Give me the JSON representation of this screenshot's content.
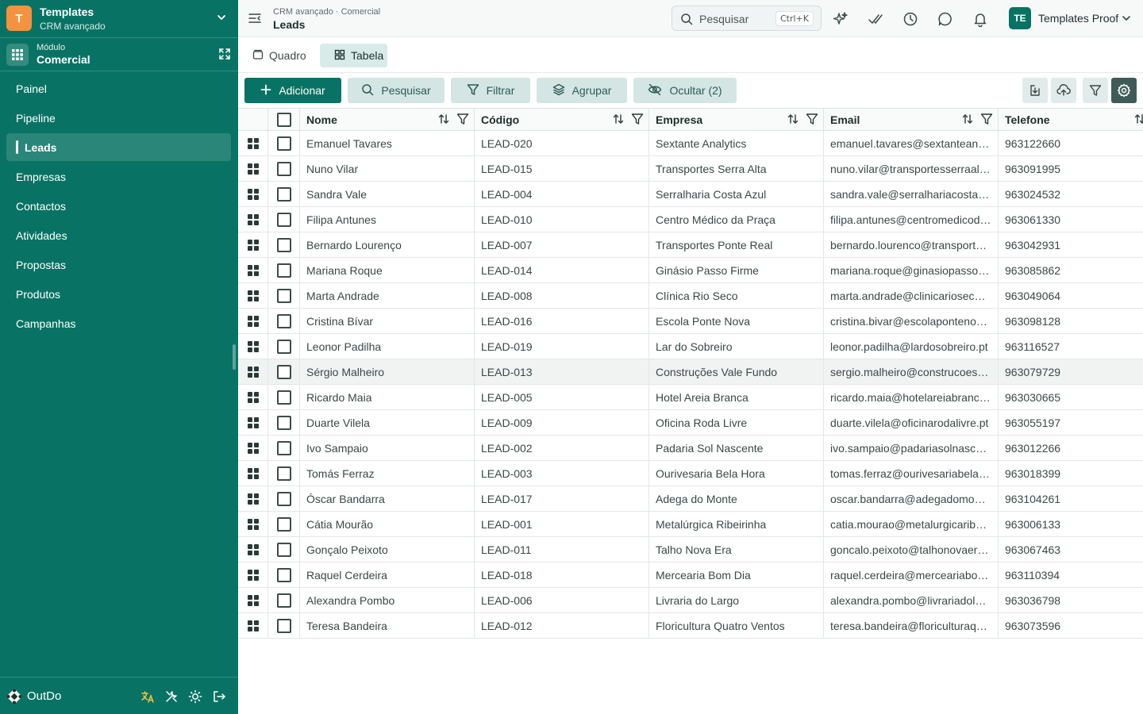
{
  "workspace": {
    "logo_letter": "T",
    "name": "Templates",
    "subtitle": "CRM avançado"
  },
  "module": {
    "label": "Módulo",
    "name": "Comercial"
  },
  "nav": [
    {
      "label": "Painel",
      "active": false
    },
    {
      "label": "Pipeline",
      "active": false
    },
    {
      "label": "Leads",
      "active": true
    },
    {
      "label": "Empresas",
      "active": false
    },
    {
      "label": "Contactos",
      "active": false
    },
    {
      "label": "Atividades",
      "active": false
    },
    {
      "label": "Propostas",
      "active": false
    },
    {
      "label": "Produtos",
      "active": false
    },
    {
      "label": "Campanhas",
      "active": false
    }
  ],
  "brand": {
    "name": "OutDo"
  },
  "header": {
    "breadcrumb": "CRM avançado · Comercial",
    "title": "Leads",
    "search_placeholder": "Pesquisar",
    "search_shortcut": "Ctrl+K",
    "user_initials": "TE",
    "user_name": "Templates Proof"
  },
  "views": {
    "board_label": "Quadro",
    "table_label": "Tabela",
    "active": "Tabela"
  },
  "toolbar": {
    "add_label": "Adicionar",
    "search_label": "Pesquisar",
    "filter_label": "Filtrar",
    "group_label": "Agrupar",
    "hide_label": "Ocultar (2)"
  },
  "columns": [
    "Nome",
    "Código",
    "Empresa",
    "Email",
    "Telefone"
  ],
  "rows": [
    {
      "nome": "Emanuel Tavares",
      "codigo": "LEAD-020",
      "empresa": "Sextante Analytics",
      "email": "emanuel.tavares@sextanteanaly…",
      "telefone": "963122660"
    },
    {
      "nome": "Nuno Vilar",
      "codigo": "LEAD-015",
      "empresa": "Transportes Serra Alta",
      "email": "nuno.vilar@transportesserraalta…",
      "telefone": "963091995"
    },
    {
      "nome": "Sandra Vale",
      "codigo": "LEAD-004",
      "empresa": "Serralharia Costa Azul",
      "email": "sandra.vale@serralhariacostaaz…",
      "telefone": "963024532"
    },
    {
      "nome": "Filipa Antunes",
      "codigo": "LEAD-010",
      "empresa": "Centro Médico da Praça",
      "email": "filipa.antunes@centromedicoda…",
      "telefone": "963061330"
    },
    {
      "nome": "Bernardo Lourenço",
      "codigo": "LEAD-007",
      "empresa": "Transportes Ponte Real",
      "email": "bernardo.lourenco@transportes…",
      "telefone": "963042931"
    },
    {
      "nome": "Mariana Roque",
      "codigo": "LEAD-014",
      "empresa": "Ginásio Passo Firme",
      "email": "mariana.roque@ginasiopassofir…",
      "telefone": "963085862"
    },
    {
      "nome": "Marta Andrade",
      "codigo": "LEAD-008",
      "empresa": "Clínica Rio Seco",
      "email": "marta.andrade@clinicarioseco.pt",
      "telefone": "963049064"
    },
    {
      "nome": "Cristina Bívar",
      "codigo": "LEAD-016",
      "empresa": "Escola Ponte Nova",
      "email": "cristina.bivar@escolapontenova…",
      "telefone": "963098128"
    },
    {
      "nome": "Leonor Padilha",
      "codigo": "LEAD-019",
      "empresa": "Lar do Sobreiro",
      "email": "leonor.padilha@lardosobreiro.pt",
      "telefone": "963116527"
    },
    {
      "nome": "Sérgio Malheiro",
      "codigo": "LEAD-013",
      "empresa": "Construções Vale Fundo",
      "email": "sergio.malheiro@construcoesva…",
      "telefone": "963079729"
    },
    {
      "nome": "Ricardo Maia",
      "codigo": "LEAD-005",
      "empresa": "Hotel Areia Branca",
      "email": "ricardo.maia@hotelareiabranca.…",
      "telefone": "963030665"
    },
    {
      "nome": "Duarte Vilela",
      "codigo": "LEAD-009",
      "empresa": "Oficina Roda Livre",
      "email": "duarte.vilela@oficinarodalivre.pt",
      "telefone": "963055197"
    },
    {
      "nome": "Ivo Sampaio",
      "codigo": "LEAD-002",
      "empresa": "Padaria Sol Nascente",
      "email": "ivo.sampaio@padariasolnascent…",
      "telefone": "963012266"
    },
    {
      "nome": "Tomás Ferraz",
      "codigo": "LEAD-003",
      "empresa": "Ourivesaria Bela Hora",
      "email": "tomas.ferraz@ourivesariabelaho…",
      "telefone": "963018399"
    },
    {
      "nome": "Óscar Bandarra",
      "codigo": "LEAD-017",
      "empresa": "Adega do Monte",
      "email": "oscar.bandarra@adegadomonte…",
      "telefone": "963104261"
    },
    {
      "nome": "Cátia Mourão",
      "codigo": "LEAD-001",
      "empresa": "Metalúrgica Ribeirinha",
      "email": "catia.mourao@metalurgicaribeir…",
      "telefone": "963006133"
    },
    {
      "nome": "Gonçalo Peixoto",
      "codigo": "LEAD-011",
      "empresa": "Talho Nova Era",
      "email": "goncalo.peixoto@talhonovaera.…",
      "telefone": "963067463"
    },
    {
      "nome": "Raquel Cerdeira",
      "codigo": "LEAD-018",
      "empresa": "Mercearia Bom Dia",
      "email": "raquel.cerdeira@merceariabom…",
      "telefone": "963110394"
    },
    {
      "nome": "Alexandra Pombo",
      "codigo": "LEAD-006",
      "empresa": "Livraria do Largo",
      "email": "alexandra.pombo@livrariadolarg…",
      "telefone": "963036798"
    },
    {
      "nome": "Teresa Bandeira",
      "codigo": "LEAD-012",
      "empresa": "Floricultura Quatro Ventos",
      "email": "teresa.bandeira@floriculturaqua…",
      "telefone": "963073596"
    }
  ],
  "highlighted_row": 9,
  "colors": {
    "brand": "#087364",
    "workspace_logo": "#f5923e",
    "highlight_row": "#f1f3f3"
  }
}
